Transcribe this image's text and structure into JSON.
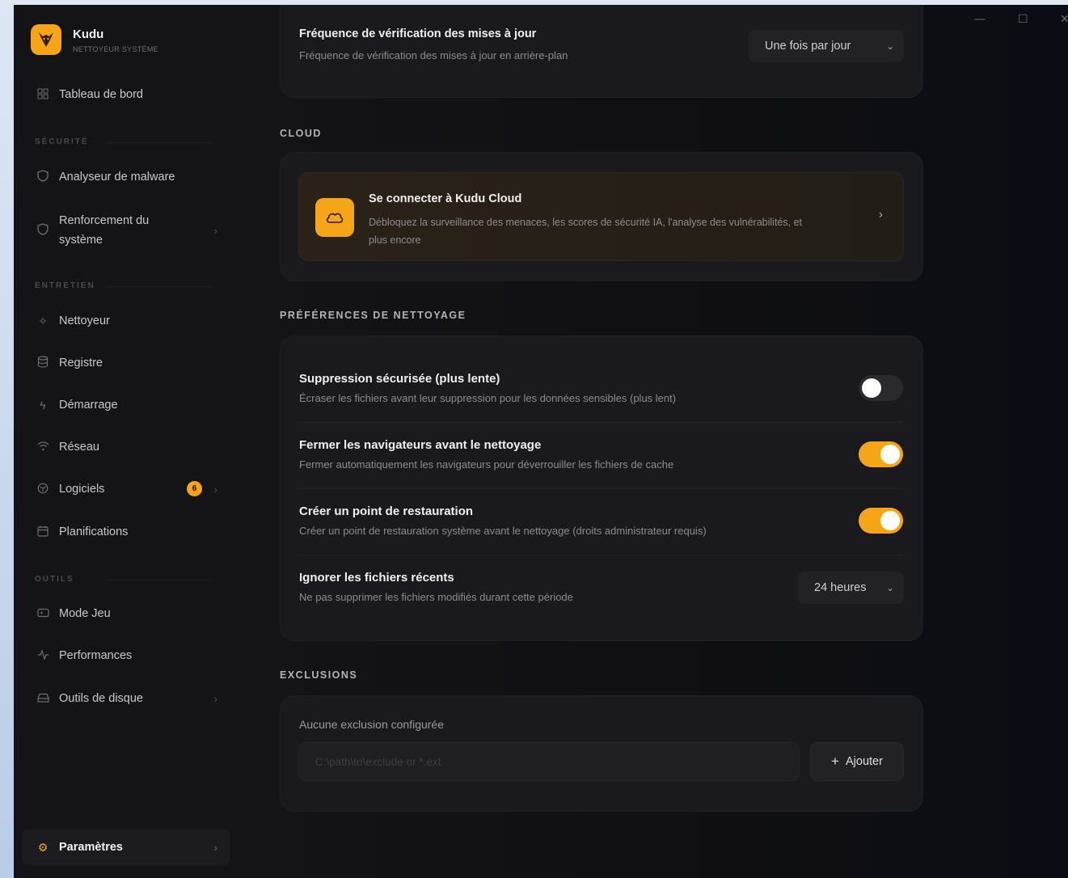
{
  "app": {
    "name": "Kudu",
    "subtitle": "NETTOYEUR SYSTÈME"
  },
  "window_controls": {
    "minimize": "—",
    "maximize": "☐",
    "close": "✕"
  },
  "sidebar": {
    "dashboard": {
      "label": "Tableau de bord",
      "icon": "grid-icon"
    },
    "sections": {
      "security": "SÉCURITÉ",
      "maintenance": "ENTRETIEN",
      "tools": "OUTILS"
    },
    "items": {
      "malware": {
        "label": "Analyseur de malware",
        "icon": "shield-icon"
      },
      "hardening_line1": "Renforcement du",
      "hardening_line2": "système",
      "cleaner": {
        "label": "Nettoyeur",
        "icon": "sparkle-icon"
      },
      "registry": {
        "label": "Registre",
        "icon": "database-icon"
      },
      "startup": {
        "label": "Démarrage",
        "icon": "lightning-icon"
      },
      "network": {
        "label": "Réseau",
        "icon": "wifi-icon"
      },
      "software": {
        "label": "Logiciels",
        "icon": "package-icon",
        "badge": "6"
      },
      "schedules": {
        "label": "Planifications",
        "icon": "calendar-icon"
      },
      "game_mode": {
        "label": "Mode Jeu",
        "icon": "gamepad-icon"
      },
      "performance": {
        "label": "Performances",
        "icon": "activity-icon"
      },
      "disk_tools": {
        "label": "Outils de disque",
        "icon": "hard-drive-icon"
      },
      "settings": {
        "label": "Paramètres",
        "icon": "gear-icon"
      }
    }
  },
  "update_check": {
    "title": "Fréquence de vérification des mises à jour",
    "description": "Fréquence de vérification des mises à jour en arrière-plan",
    "value": "Une fois par jour"
  },
  "cloud": {
    "section_title": "CLOUD",
    "title": "Se connecter à Kudu Cloud",
    "description_line1": "Débloquez la surveillance des menaces, les scores de sécurité IA, l'analyse des vulnérabilités, et",
    "description_line2": "plus encore"
  },
  "cleaning": {
    "section_title": "PRÉFÉRENCES DE NETTOYAGE",
    "secure_delete": {
      "title": "Suppression sécurisée (plus lente)",
      "description": "Écraser les fichiers avant leur suppression pour les données sensibles (plus lent)",
      "enabled": false
    },
    "close_browsers": {
      "title": "Fermer les navigateurs avant le nettoyage",
      "description": "Fermer automatiquement les navigateurs pour déverrouiller les fichiers de cache",
      "enabled": true
    },
    "restore_point": {
      "title": "Créer un point de restauration",
      "description": "Créer un point de restauration système avant le nettoyage (droits administrateur requis)",
      "enabled": true
    },
    "ignore_recent": {
      "title": "Ignorer les fichiers récents",
      "description": "Ne pas supprimer les fichiers modifiés durant cette période",
      "value": "24 heures"
    }
  },
  "exclusions": {
    "section_title": "EXCLUSIONS",
    "empty_text": "Aucune exclusion configurée",
    "input_placeholder": "C:\\path\\to\\exclude or *.ext",
    "add_label": "Ajouter"
  },
  "colors": {
    "accent": "#f5a515",
    "background": "#101013",
    "card": "#1a1a1e"
  }
}
